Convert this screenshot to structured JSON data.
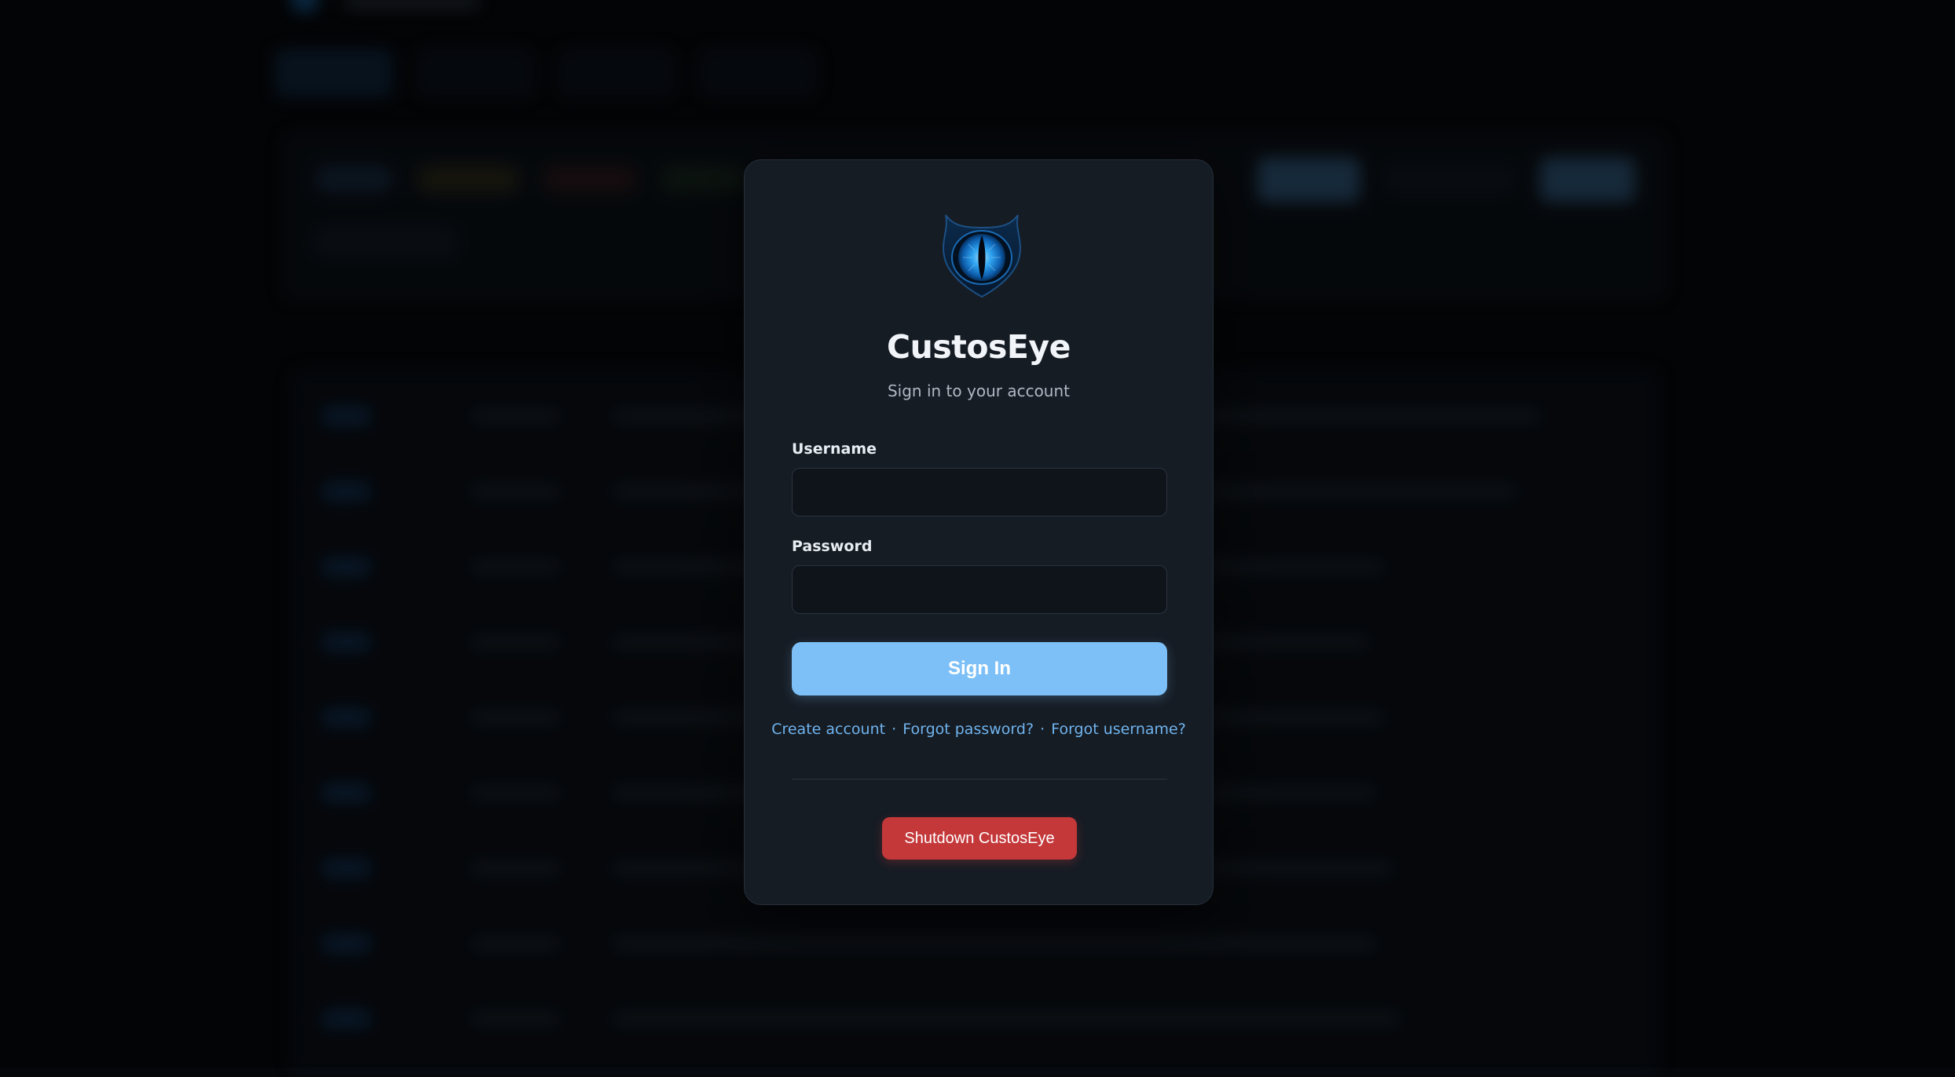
{
  "app": {
    "name": "CustosEye",
    "subtitle": "Sign in to your account"
  },
  "form": {
    "username_label": "Username",
    "username_value": "",
    "password_label": "Password",
    "password_value": "",
    "submit_label": "Sign In"
  },
  "links": {
    "create_account": "Create account",
    "separator": "·",
    "forgot_password": "Forgot password?",
    "forgot_username": "Forgot username?"
  },
  "shutdown": {
    "label": "Shutdown CustosEye"
  },
  "icons": {
    "logo": "eye-logo-icon"
  },
  "colors": {
    "accent": "#7cc0f7",
    "link": "#6fb4ee",
    "danger": "#c4383a",
    "card_bg": "#161c24",
    "page_bg": "#05070a"
  }
}
